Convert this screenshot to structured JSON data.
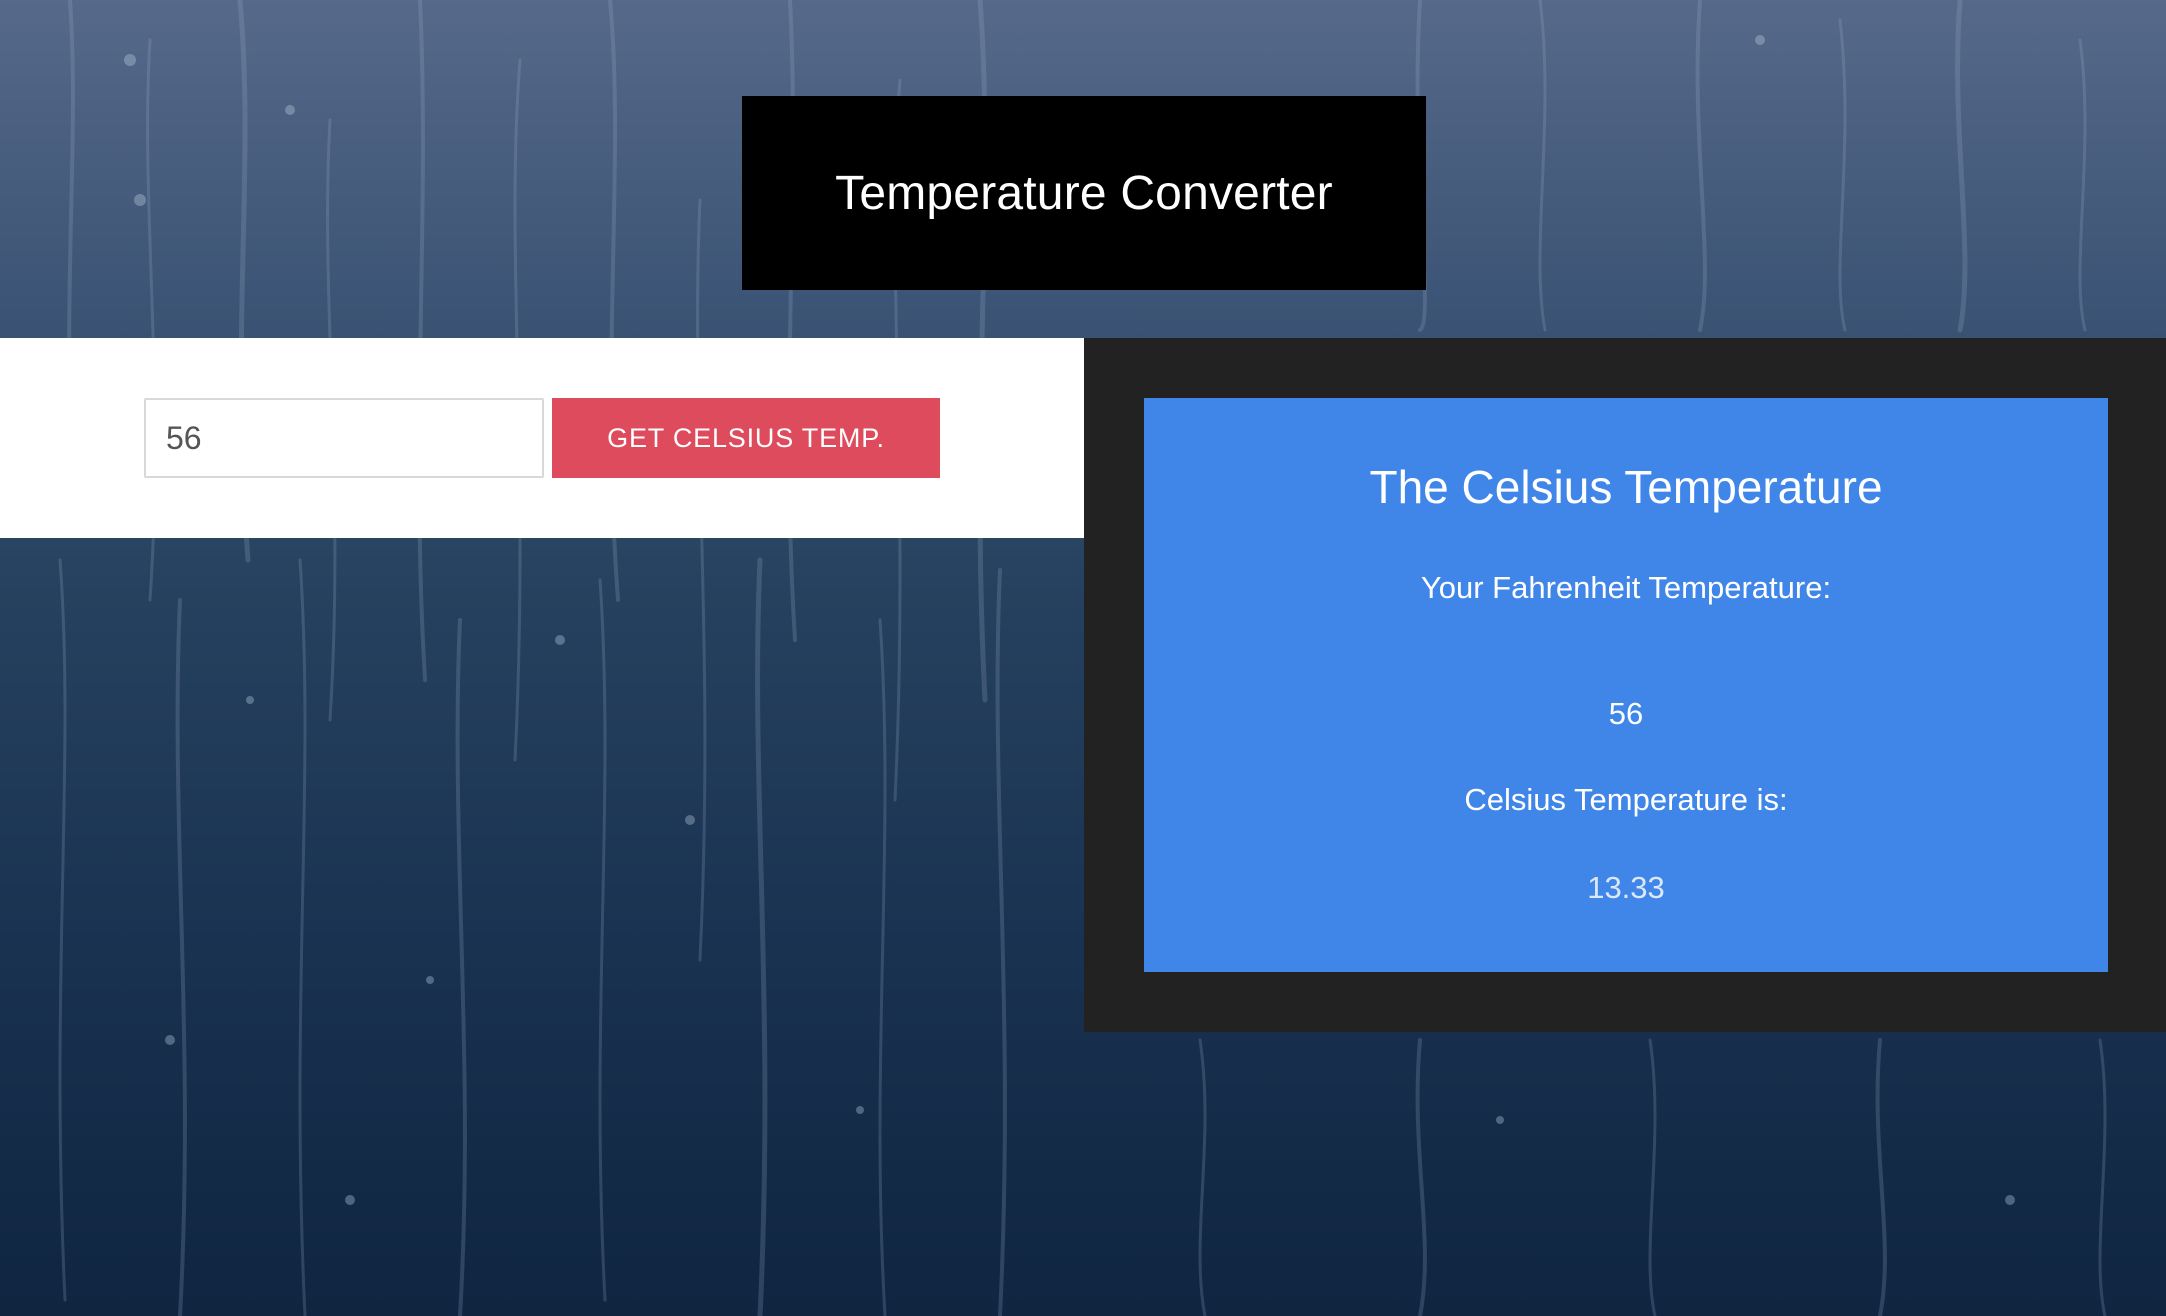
{
  "app": {
    "title": "Temperature Converter"
  },
  "form": {
    "input_value": "56",
    "button_label": "GET CELSIUS TEMP."
  },
  "result": {
    "heading": "The Celsius Temperature",
    "fahrenheit_label": "Your Fahrenheit Temperature:",
    "fahrenheit_value": "56",
    "celsius_label": "Celsius Temperature is:",
    "celsius_value": "13.33"
  },
  "colors": {
    "title_bg": "#000000",
    "button_bg": "#de4b5d",
    "result_panel_bg": "#222222",
    "result_card_bg": "#3f86e8"
  }
}
